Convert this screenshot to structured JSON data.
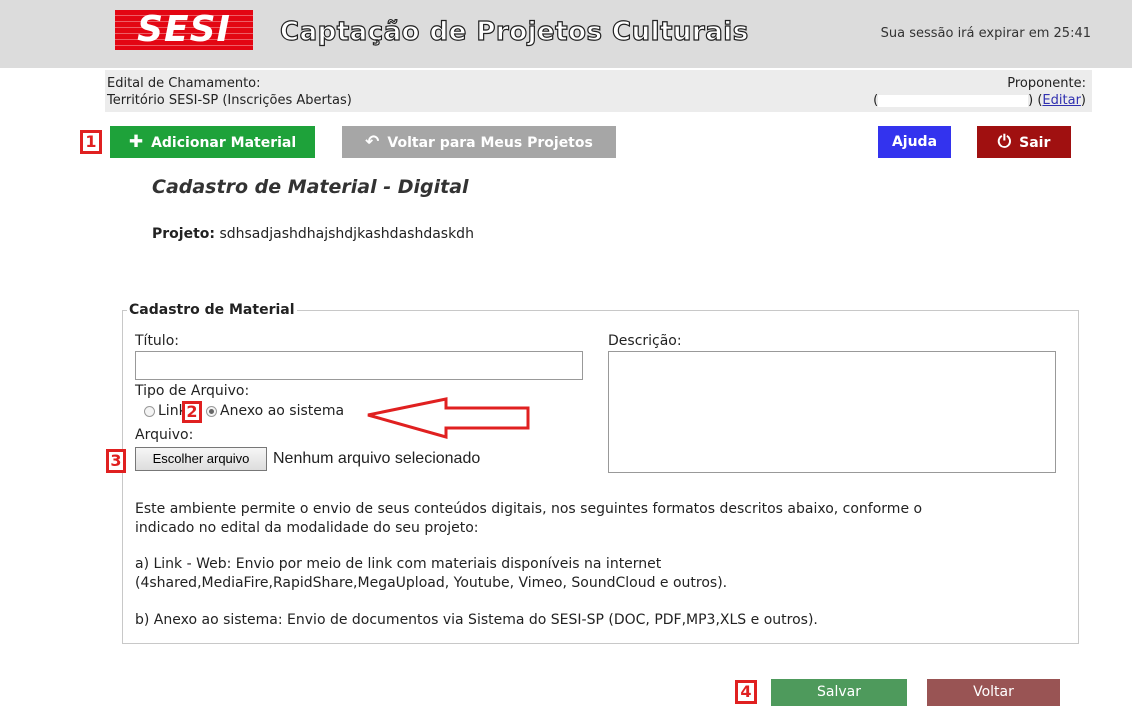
{
  "header": {
    "logo": "SESI",
    "title": "Captação de Projetos Culturais",
    "session_text": "Sua sessão irá expirar em 25:41"
  },
  "info": {
    "edital_label": "Edital de Chamamento:",
    "edital_value": "Território SESI-SP (Inscrições Abertas)",
    "proponente_label": "Proponente:",
    "proponente_open": "(",
    "proponente_close": ") (",
    "edit_link": "Editar",
    "proponente_end": ")"
  },
  "toolbar": {
    "add_material": "Adicionar Material",
    "back_projects": "Voltar para Meus Projetos",
    "help": "Ajuda",
    "exit": "Sair"
  },
  "page": {
    "heading": "Cadastro de Material - Digital",
    "project_label": "Projeto:",
    "project_value": "sdhsadjashdhajshdjkashdashdaskdh"
  },
  "form": {
    "legend": "Cadastro de Material",
    "title_label": "Título:",
    "title_value": "",
    "description_label": "Descrição:",
    "description_value": "",
    "file_type_label": "Tipo de Arquivo:",
    "option_link": "Link",
    "option_attach": "Anexo ao sistema",
    "selected_option": "Anexo ao sistema",
    "file_label": "Arquivo:",
    "choose_file": "Escolher arquivo",
    "no_file": "Nenhum arquivo selecionado",
    "info_line1": "Este ambiente permite o envio de seus conteúdos digitais, nos seguintes formatos descritos abaixo, conforme o",
    "info_line2": "indicado no edital da modalidade do seu projeto:",
    "link_line1": "a) Link - Web: Envio por meio de link com materiais disponíveis na internet",
    "link_line2": "(4shared,MediaFire,RapidShare,MegaUpload, Youtube, Vimeo, SoundCloud e outros).",
    "attach_line": "b) Anexo ao sistema: Envio de documentos via Sistema do SESI-SP (DOC, PDF,MP3,XLS e outros)."
  },
  "actions": {
    "save": "Salvar",
    "back": "Voltar"
  },
  "markers": [
    "1",
    "2",
    "3",
    "4"
  ],
  "colors": {
    "add_button": "#1ea23a",
    "back_button": "#a6a6a6",
    "help_button": "#3333ee",
    "exit_button": "#a01010",
    "save_button": "#4e9a5c",
    "return_button": "#995454",
    "annotation": "#e02020"
  },
  "icons": {
    "add": "plus-icon",
    "back": "undo-icon",
    "exit": "power-icon"
  }
}
